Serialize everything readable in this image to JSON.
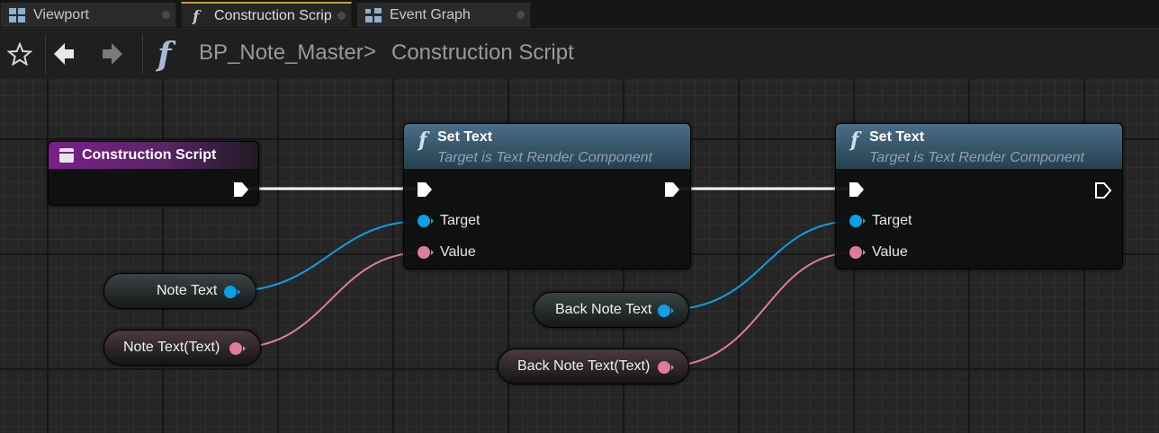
{
  "tabs": [
    {
      "label": "Viewport",
      "icon": "viewport-grid-icon"
    },
    {
      "label": "Construction Scrip",
      "icon": "function-icon",
      "active": true
    },
    {
      "label": "Event Graph",
      "icon": "event-graph-icon"
    }
  ],
  "breadcrumb": {
    "blueprint": "BP_Note_Master",
    "separator": ">",
    "graph": "Construction Script"
  },
  "nodes": {
    "entry": {
      "title": "Construction Script"
    },
    "set_text_1": {
      "title": "Set Text",
      "subtitle": "Target is Text Render Component",
      "target_label": "Target",
      "value_label": "Value"
    },
    "set_text_2": {
      "title": "Set Text",
      "subtitle": "Target is Text Render Component",
      "target_label": "Target",
      "value_label": "Value"
    }
  },
  "getters": {
    "note_text": "Note Text",
    "note_text_text": "Note Text(Text)",
    "back_note_text": "Back Note Text",
    "back_note_text_text": "Back Note Text(Text)"
  },
  "colors": {
    "object_pin": "#0aa0e6",
    "text_pin": "#e07ba0",
    "exec_pin": "#ffffff",
    "entry_header": "#7a1f8a",
    "function_header": "#3b5a72",
    "active_tab_accent": "#c9a237"
  }
}
